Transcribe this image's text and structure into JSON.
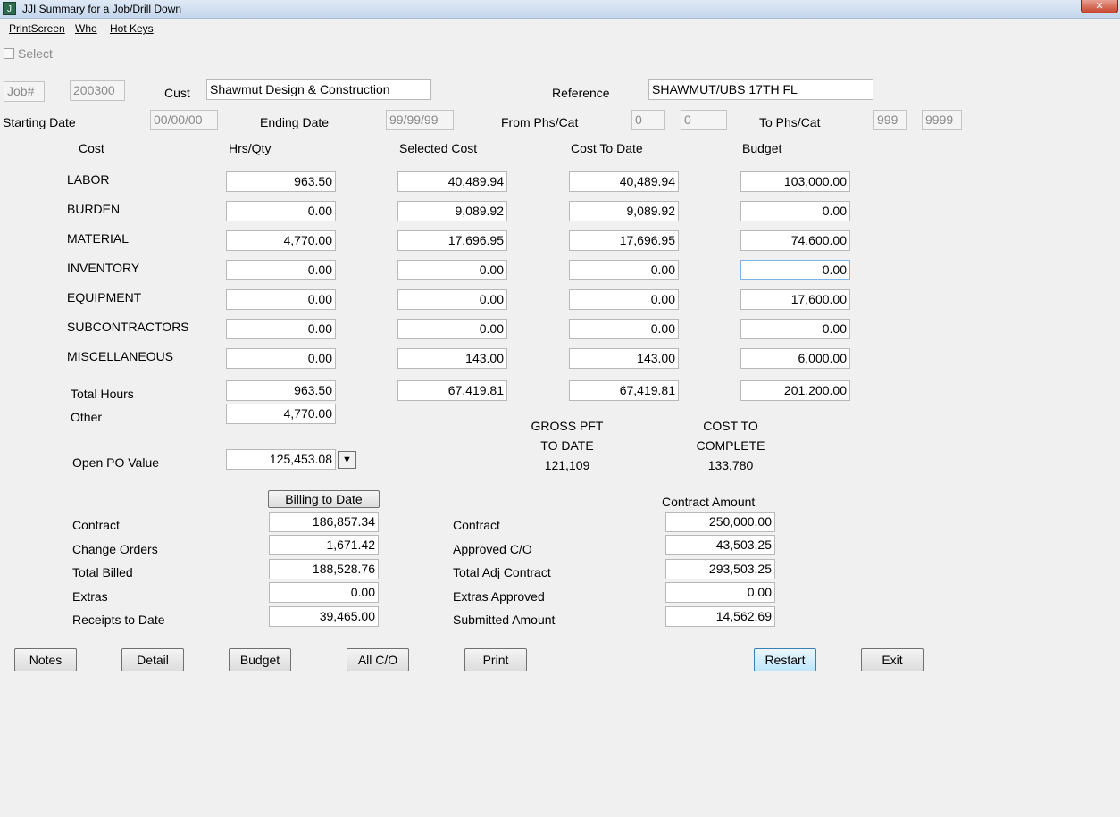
{
  "window": {
    "title": "JJI   Summary for a Job/Drill Down",
    "close_symbol": "✕",
    "app_icon_text": "J"
  },
  "menu": [
    "PrintScreen",
    "Who",
    "Hot Keys"
  ],
  "select_label": "Select",
  "header": {
    "job_label": "Job#",
    "job_value": "200300",
    "cust_label": "Cust",
    "cust_value": "Shawmut Design & Construction",
    "reference_label": "Reference",
    "reference_value": "SHAWMUT/UBS 17TH FL",
    "starting_date_label": "Starting Date",
    "starting_date_value": "00/00/00",
    "ending_date_label": "Ending Date",
    "ending_date_value": "99/99/99",
    "from_phs_label": "From Phs/Cat",
    "from_phs_value": "0",
    "from_cat_value": "0",
    "to_phs_label": "To Phs/Cat",
    "to_phs_value": "999",
    "to_cat_value": "9999"
  },
  "cost_table": {
    "columns": [
      "Cost",
      "Hrs/Qty",
      "Selected Cost",
      "Cost To Date",
      "Budget"
    ],
    "rows": [
      {
        "label": "LABOR",
        "hrs": "963.50",
        "selected": "40,489.94",
        "to_date": "40,489.94",
        "budget": "103,000.00"
      },
      {
        "label": "BURDEN",
        "hrs": "0.00",
        "selected": "9,089.92",
        "to_date": "9,089.92",
        "budget": "0.00"
      },
      {
        "label": "MATERIAL",
        "hrs": "4,770.00",
        "selected": "17,696.95",
        "to_date": "17,696.95",
        "budget": "74,600.00"
      },
      {
        "label": "INVENTORY",
        "hrs": "0.00",
        "selected": "0.00",
        "to_date": "0.00",
        "budget": "0.00"
      },
      {
        "label": "EQUIPMENT",
        "hrs": "0.00",
        "selected": "0.00",
        "to_date": "0.00",
        "budget": "17,600.00"
      },
      {
        "label": "SUBCONTRACTORS",
        "hrs": "0.00",
        "selected": "0.00",
        "to_date": "0.00",
        "budget": "0.00"
      },
      {
        "label": "MISCELLANEOUS",
        "hrs": "0.00",
        "selected": "143.00",
        "to_date": "143.00",
        "budget": "6,000.00"
      }
    ],
    "total_hours_label": "Total Hours",
    "total_hours": "963.50",
    "total_selected": "67,419.81",
    "total_to_date": "67,419.81",
    "total_budget": "201,200.00",
    "other_label": "Other",
    "other_value": "4,770.00"
  },
  "open_po": {
    "label": "Open PO Value",
    "value": "125,453.08",
    "dropdown_symbol": "▼"
  },
  "gross_pft": {
    "line1": "GROSS PFT",
    "line2": "TO DATE",
    "value": "121,109"
  },
  "cost_to_complete": {
    "line1": "COST TO",
    "line2": "COMPLETE",
    "value": "133,780"
  },
  "billing": {
    "button_label": "Billing to Date",
    "rows": [
      {
        "label": "Contract",
        "value": "186,857.34"
      },
      {
        "label": "Change Orders",
        "value": "1,671.42"
      },
      {
        "label": "Total Billed",
        "value": "188,528.76"
      },
      {
        "label": "Extras",
        "value": "0.00"
      },
      {
        "label": "Receipts to Date",
        "value": "39,465.00"
      }
    ]
  },
  "contract": {
    "header": "Contract Amount",
    "rows": [
      {
        "label": "Contract",
        "value": "250,000.00"
      },
      {
        "label": "Approved C/O",
        "value": "43,503.25"
      },
      {
        "label": "Total Adj Contract",
        "value": "293,503.25"
      },
      {
        "label": "Extras Approved",
        "value": "0.00"
      },
      {
        "label": "Submitted Amount",
        "value": "14,562.69"
      }
    ]
  },
  "buttons": {
    "notes": "Notes",
    "detail": "Detail",
    "budget": "Budget",
    "all_co": "All C/O",
    "print": "Print",
    "restart": "Restart",
    "exit": "Exit"
  }
}
